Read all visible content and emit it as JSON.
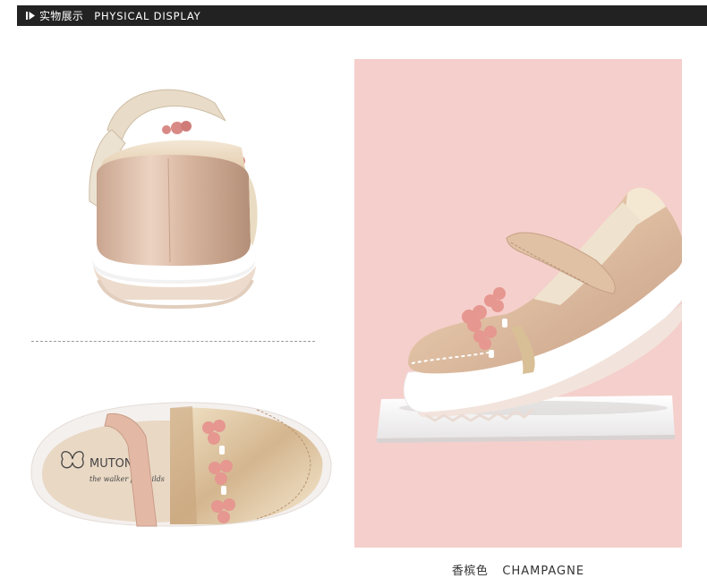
{
  "header": {
    "title_cn": "实物展示",
    "title_en": "PHYSICAL DISPLAY",
    "background": "#222222"
  },
  "panel": {
    "background": "#f5cfcb",
    "color_name_cn": "香槟色",
    "color_name_en": "CHAMPAGNE"
  },
  "insole_logo": {
    "brand": "MUTONG",
    "tagline": "the walker for childs"
  },
  "icons": [
    "play-marker-icon"
  ]
}
